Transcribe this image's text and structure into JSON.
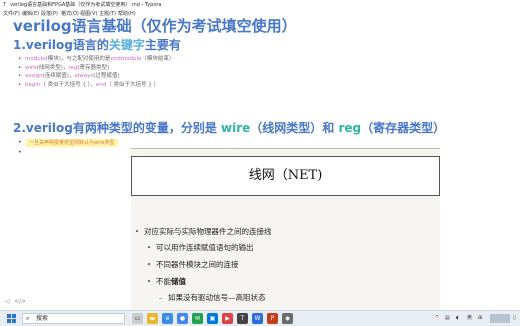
{
  "window": {
    "title": "verilog语言基础和FPGA基础（仅作为考试填空使用）.md - Typora"
  },
  "menu": [
    "文件(F)",
    "编辑(E)",
    "段落(P)",
    "格式(O)",
    "视图(V)",
    "主题(T)",
    "帮助(H)"
  ],
  "doc": {
    "h1": "verilog语言基础（仅作为考试填空使用）",
    "h2_1": {
      "pre": "1.verilog语言的",
      "kw": "关键字",
      "post": "主要有"
    },
    "keywords": [
      {
        "kw": "module",
        "rest": "(模块)，与之配对使用的是",
        "kw2": "endmodule",
        "rest2": "（模块结束）"
      },
      {
        "kw": "wire",
        "rest": "(线网类型)，",
        "kw2": "reg",
        "rest2": "(寄存器类型)"
      },
      {
        "kw": "assign",
        "rest": "(连续赋值)，",
        "kw2": "always",
        "rest2": "(过程赋值)"
      },
      {
        "kw": "begin",
        "rest": "（ 类似于大括号 { ），",
        "kw2": "end",
        "rest2": "（ 类似于大括号 } ）"
      }
    ],
    "h2_2": {
      "pre": "2.verilog有两种类型的变量，分别是 ",
      "kw1": "wire",
      "mid": "（线网类型）和 ",
      "kw2": "reg",
      "post": "（寄存器类型）"
    },
    "highlight": "一旦关声明变量类型则默认为wire类型"
  },
  "slide": {
    "title": "线网（NET)",
    "items": [
      {
        "level": 1,
        "text": "对应实际与实际物理器件之间的连接线"
      },
      {
        "level": 2,
        "text": "可以用作连续赋值语句的输出"
      },
      {
        "level": 2,
        "text": "不同器件模块之间的连接"
      },
      {
        "level": 2,
        "pre": "不能",
        "bold": "储值"
      },
      {
        "level": 3,
        "text": "如果没有驱动信号—高阻状态"
      }
    ]
  },
  "taskbar": {
    "search_text": "搜索",
    "tray_text": "英"
  },
  "colors": {
    "heading": "#4a78c8",
    "keyword": "#d06ad0",
    "highlight_bg": "#fdf6a8"
  }
}
